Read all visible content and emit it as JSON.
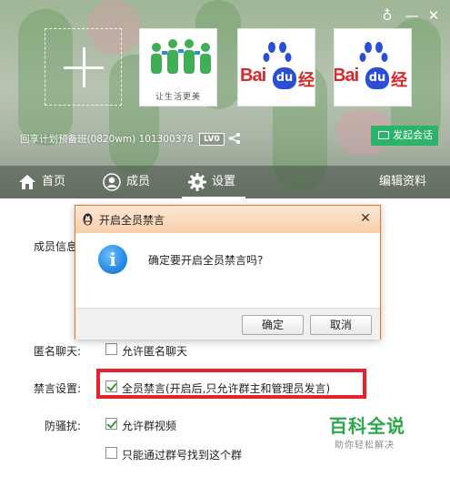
{
  "colors": {
    "accent_green": "#2bb26b",
    "highlight_red": "#e3232d",
    "dialog_border": "#d77a2e",
    "info_blue": "#2b8fe6",
    "watermark_green": "#2aa84a"
  },
  "header": {
    "group_name": "回享计划预备班(0820wm)",
    "group_id": "101300378",
    "level_badge": "LV0",
    "start_chat_label": "发起会话",
    "thumb1_caption": "让生活更美",
    "thumb_brand_text": "Bai",
    "thumb_brand_du": "du",
    "thumb_brand_suffix": "经"
  },
  "tabs": {
    "home": "首页",
    "members": "成员",
    "settings": "设置",
    "edit": "编辑资料"
  },
  "settings": {
    "member_info_label": "成员信息",
    "anonymous_label": "匿名聊天:",
    "anonymous_option": "允许匿名聊天",
    "mute_label": "禁言设置:",
    "mute_option": "全员禁言(开启后,只允许群主和管理员发言)",
    "harass_label": "防骚扰:",
    "video_option": "允许群视频",
    "search_option": "只能通过群号找到这个群"
  },
  "dialog": {
    "title": "开启全员禁言",
    "message": "确定要开启全员禁言吗?",
    "confirm": "确定",
    "cancel": "取消",
    "icon_letter": "i"
  },
  "watermark": {
    "title": "百科全说",
    "subtitle": "助你轻松解决"
  }
}
